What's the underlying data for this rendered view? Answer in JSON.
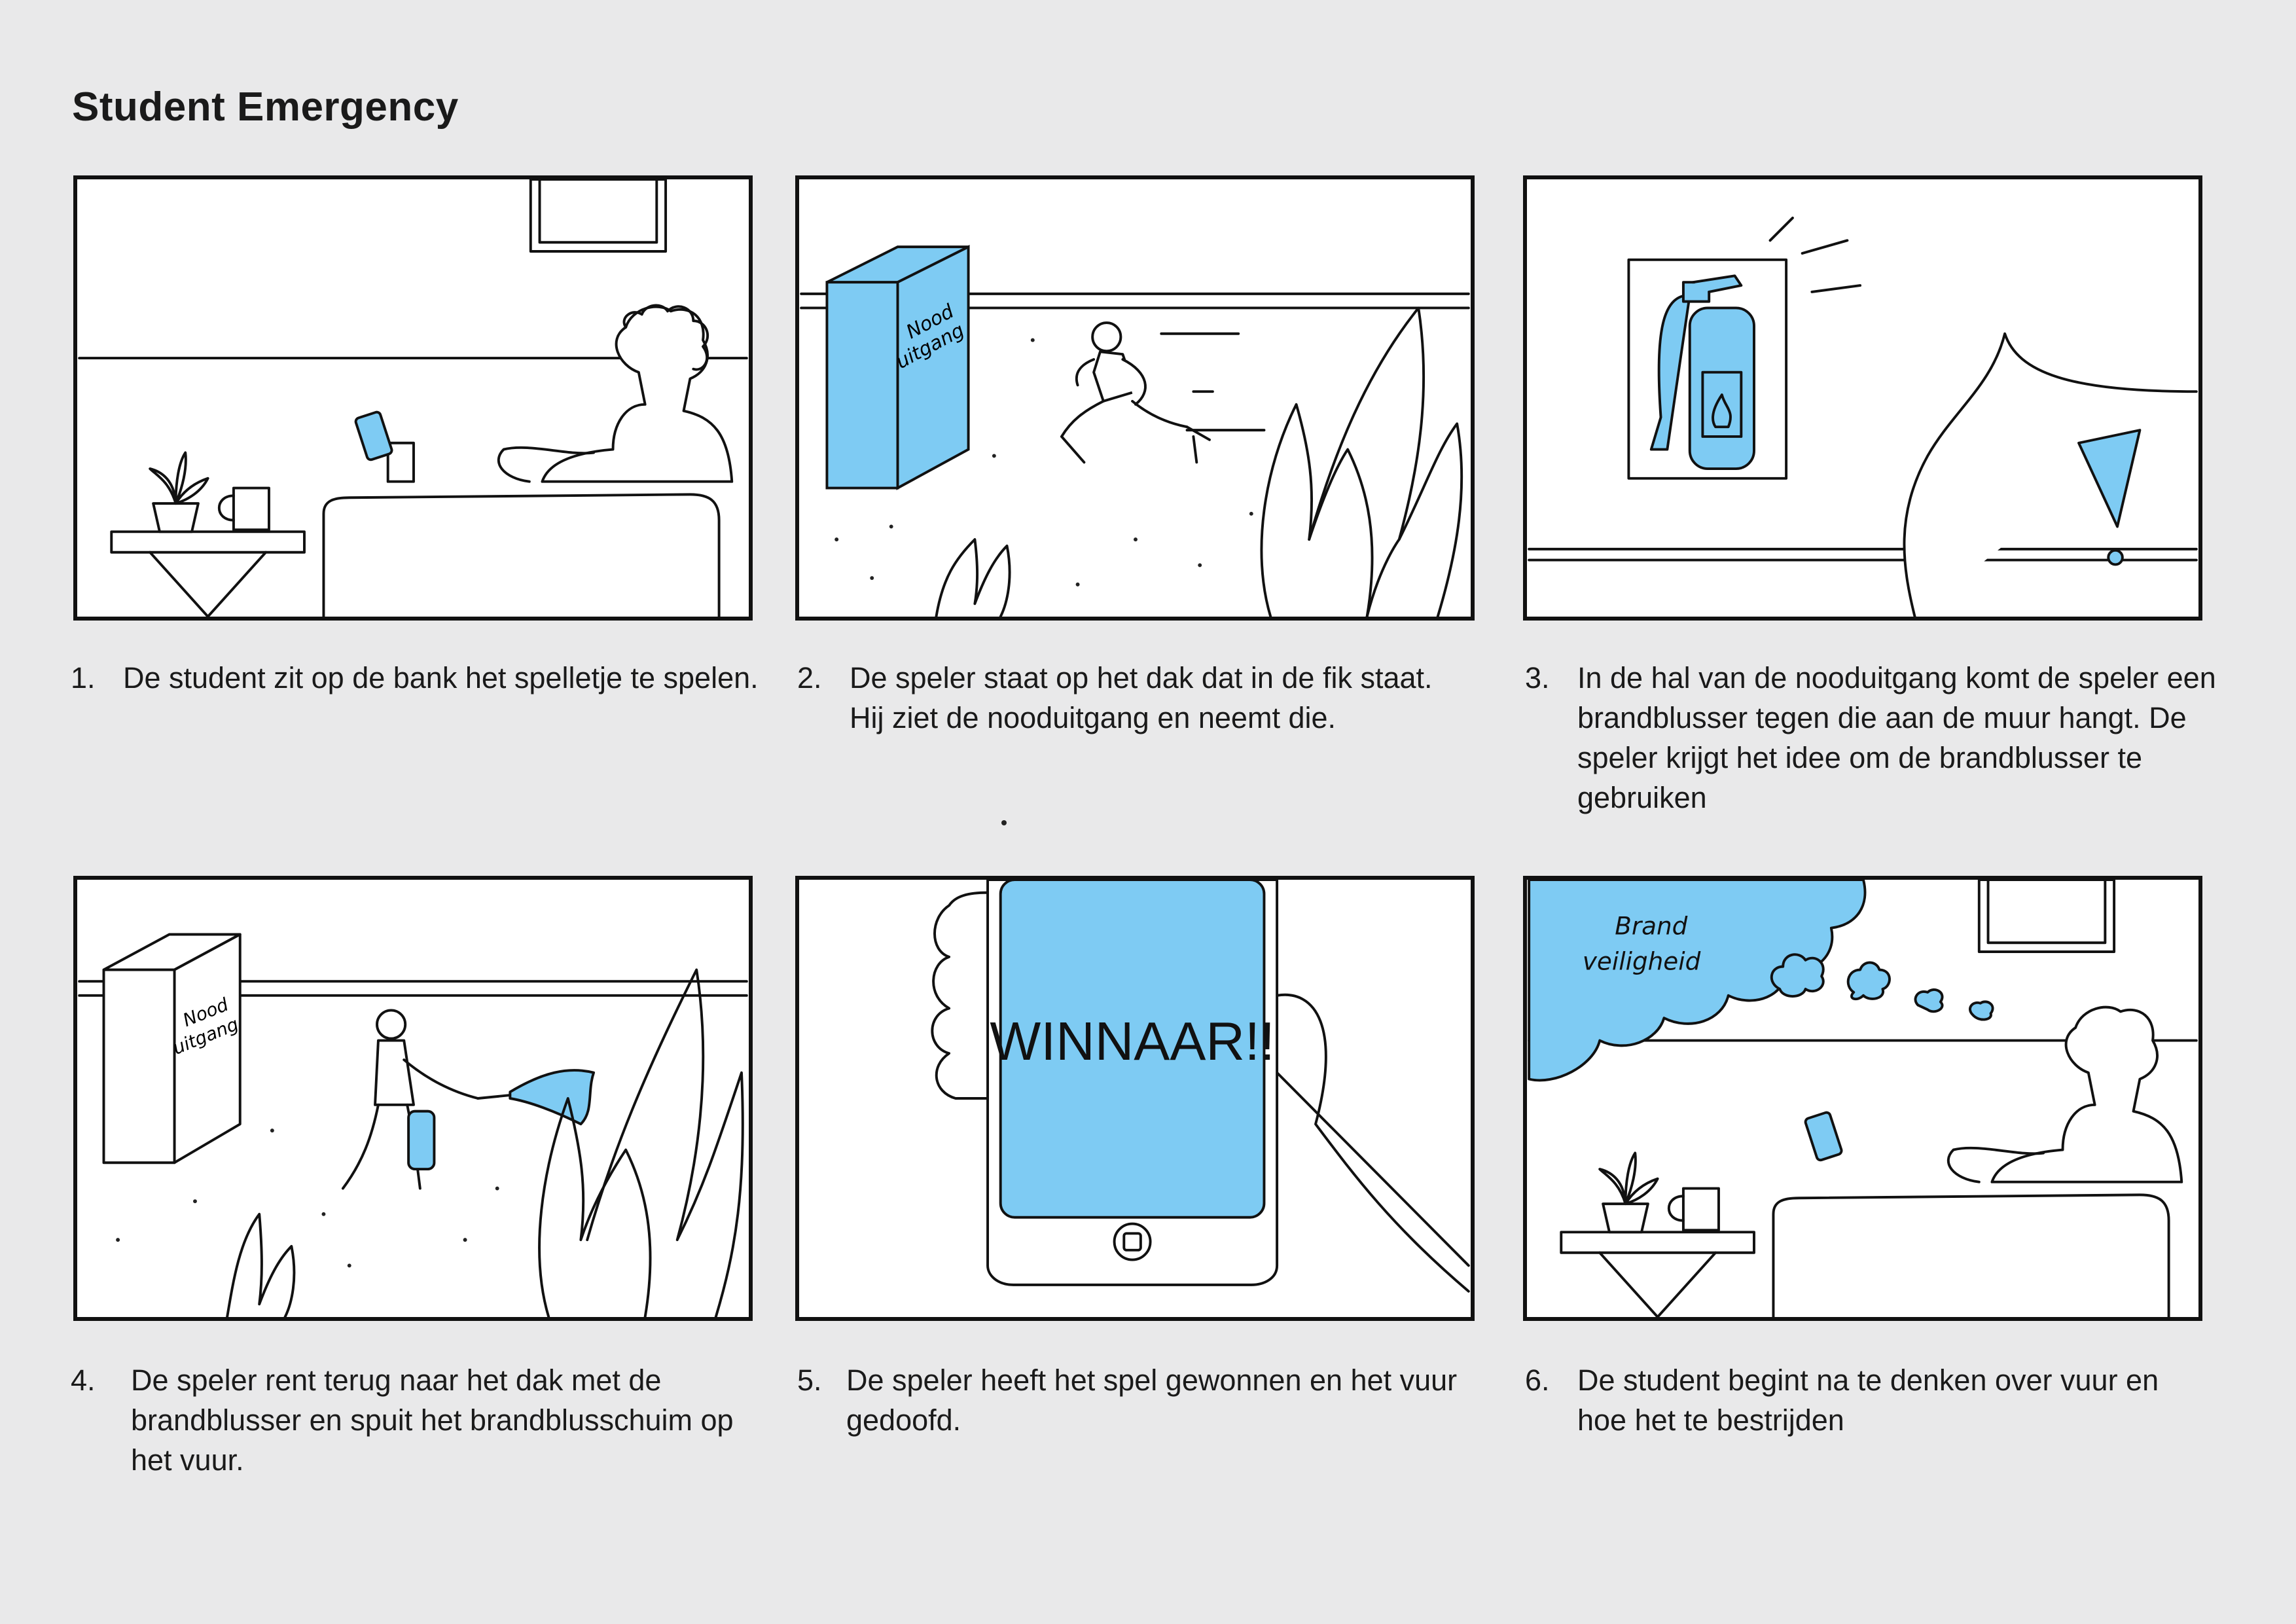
{
  "title": "Student Emergency",
  "colors": {
    "accent": "#7ecbf3",
    "ink": "#111111",
    "background": "#e9e9ea"
  },
  "panels": [
    {
      "number": "1.",
      "caption": "De student zit op de bank het spelletje te spelen."
    },
    {
      "number": "2.",
      "caption": "De speler staat op het dak dat in de fik staat. Hij ziet de nooduitgang en neemt die.",
      "sign": [
        "Nood",
        "uitgang"
      ]
    },
    {
      "number": "3.",
      "caption": "In de hal van de nooduitgang komt de speler een brandblusser tegen die aan de muur hangt. De speler krijgt het idee om de brandblusser te gebruiken"
    },
    {
      "number": "4.",
      "caption": "De speler rent terug naar het dak met de brandblusser en spuit het brandblusschuim op het vuur.",
      "sign": [
        "Nood",
        "uitgang"
      ]
    },
    {
      "number": "5.",
      "caption": "De speler heeft het spel gewonnen en het vuur gedoofd.",
      "screen_text": "WINNAAR!!"
    },
    {
      "number": "6.",
      "caption": "De student begint na te denken over vuur en hoe het te bestrijden",
      "thought": [
        "Brand",
        "veiligheid"
      ]
    }
  ]
}
